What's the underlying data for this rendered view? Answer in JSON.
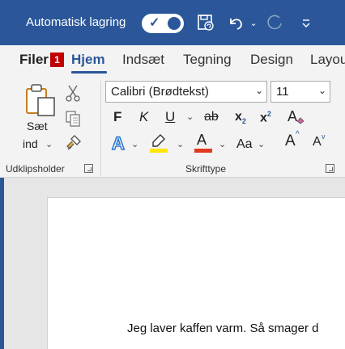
{
  "titlebar": {
    "autosave_label": "Automatisk lagring",
    "autosave_on": true
  },
  "tabs": {
    "file": "Filer",
    "file_key": "1",
    "items": [
      "Hjem",
      "Indsæt",
      "Tegning",
      "Design",
      "Layou"
    ]
  },
  "ribbon": {
    "clipboard": {
      "paste_line1": "Sæt",
      "paste_line2": "ind",
      "group_label": "Udklipsholder"
    },
    "font": {
      "font_name": "Calibri (Brødtekst)",
      "font_size": "11",
      "bold": "F",
      "italic": "K",
      "underline": "U",
      "strike": "ab",
      "subscript": "x",
      "subscript_mark": "2",
      "superscript": "x",
      "superscript_mark": "2",
      "change_case": "Aa",
      "grow": "A",
      "shrink": "A",
      "clear": "A",
      "group_label": "Skrifttype",
      "highlight_color": "#ffe600",
      "font_color": "#e03a1e"
    }
  },
  "document": {
    "text": "Jeg laver kaffen varm. Så smager d"
  },
  "colors": {
    "accent": "#2b579a"
  }
}
